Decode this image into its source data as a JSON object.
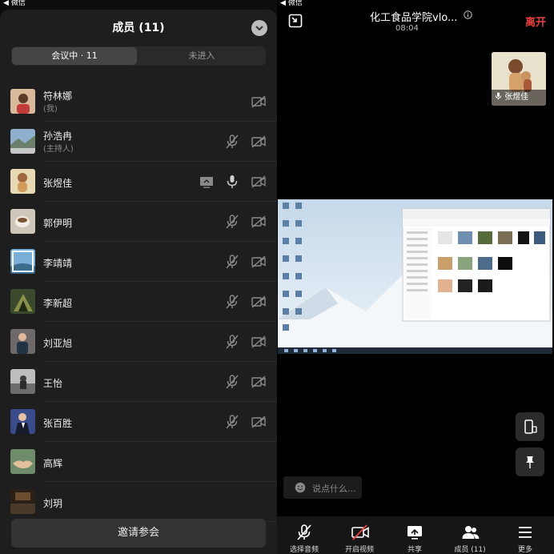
{
  "status": {
    "left_back": "◀ 微信",
    "right_back": "◀ 微信"
  },
  "members_panel": {
    "title": "成员 (11)",
    "tabs": [
      {
        "label": "会议中 · 11"
      },
      {
        "label": "未进入"
      }
    ],
    "members": [
      {
        "name": "符林娜",
        "sub": "(我)",
        "avatar": "portrait"
      },
      {
        "name": "孙浩冉",
        "sub": "(主持人)",
        "avatar": "landscape"
      },
      {
        "name": "张煜佳",
        "sub": "",
        "avatar": "pet"
      },
      {
        "name": "郭伊明",
        "sub": "",
        "avatar": "cup"
      },
      {
        "name": "李靖靖",
        "sub": "",
        "avatar": "sky"
      },
      {
        "name": "李新超",
        "sub": "",
        "avatar": "leaves"
      },
      {
        "name": "刘亚旭",
        "sub": "",
        "avatar": "person"
      },
      {
        "name": "王怡",
        "sub": "",
        "avatar": "street"
      },
      {
        "name": "张百胜",
        "sub": "",
        "avatar": "suit"
      },
      {
        "name": "高辉",
        "sub": "",
        "avatar": "handshake"
      },
      {
        "name": "刘玥",
        "sub": "",
        "avatar": "dark"
      }
    ],
    "invite_label": "邀请参会"
  },
  "meeting": {
    "title": "化工食品学院vlo...",
    "timer": "08:04",
    "leave_label": "离开",
    "speaker_name": "张煜佳",
    "chat_placeholder": "说点什么...",
    "toolbar": [
      {
        "label": "选择音频",
        "icon": "mic-muted-icon"
      },
      {
        "label": "开启视频",
        "icon": "camera-off-icon"
      },
      {
        "label": "共享",
        "icon": "share-screen-icon"
      },
      {
        "label": "成员 (11)",
        "icon": "members-icon"
      },
      {
        "label": "更多",
        "icon": "menu-icon"
      }
    ]
  },
  "colors": {
    "leave": "#e9413f",
    "panel": "#1e1e1e",
    "muted_icon": "#8a8a8a"
  }
}
